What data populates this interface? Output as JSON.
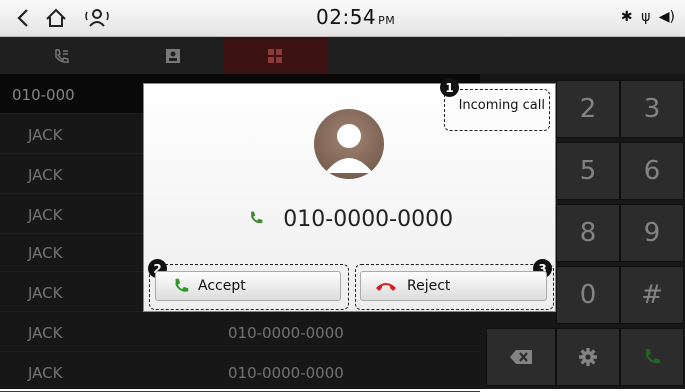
{
  "status_bar": {
    "back_icon": "chevron-left-icon",
    "home_icon": "home-icon",
    "voice_icon": "voice-recognition-icon",
    "time": "02:54",
    "ampm": "PM",
    "bluetooth_icon": "bluetooth-icon",
    "usb_icon": "usb-icon",
    "volume_icon": "volume-icon"
  },
  "tabs": [
    {
      "icon": "call-history-icon"
    },
    {
      "icon": "contacts-icon"
    },
    {
      "icon": "dialpad-icon",
      "active": true
    }
  ],
  "list": {
    "rows": [
      {
        "name": "010-000",
        "number": ""
      },
      {
        "name": "JACK",
        "number": ""
      },
      {
        "name": "JACK",
        "number": ""
      },
      {
        "name": "JACK",
        "number": ""
      },
      {
        "name": "JACK",
        "number": ""
      },
      {
        "name": "JACK",
        "number": ""
      },
      {
        "name": "JACK",
        "number": "010-0000-0000"
      },
      {
        "name": "JACK",
        "number": "010-0000-0000"
      }
    ]
  },
  "keypad": {
    "keys": [
      "2",
      "3",
      "5",
      "6",
      "8",
      "9",
      "0",
      "#"
    ],
    "backspace_icon": "backspace-icon",
    "settings_icon": "gear-icon",
    "call_icon": "phone-icon"
  },
  "popup": {
    "title": "Incoming call",
    "caller_number": "010-0000-0000",
    "accept_label": "Accept",
    "reject_label": "Reject",
    "accept_color": "#2e9a2e",
    "reject_color": "#d42020"
  },
  "callouts": {
    "one": "1",
    "two": "2",
    "three": "3"
  }
}
